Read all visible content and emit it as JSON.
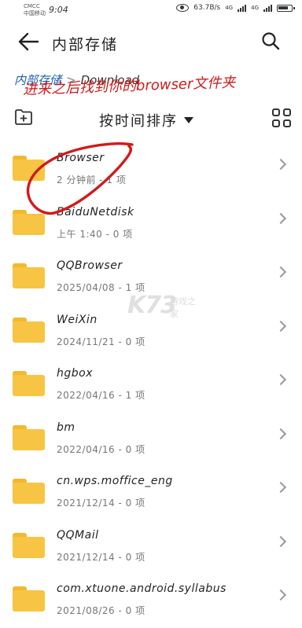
{
  "status_bar": {
    "carrier_top": "CMCC",
    "carrier_bottom": "中国移动",
    "time": "9:04",
    "network_speed": "63.7B/s",
    "signal_1": "4G",
    "signal_2": "4G"
  },
  "app_bar": {
    "title": "内部存储",
    "back_icon": "arrow-left-icon",
    "search_icon": "search-icon"
  },
  "breadcrumb": {
    "root": "内部存储",
    "separator": ">",
    "current": "Download"
  },
  "annotation_text": "进来之后找到你的browser文件夹",
  "toolbar": {
    "sort_label": "按时间排序",
    "new_folder_icon": "new-folder-icon",
    "view_icon": "grid-view-icon"
  },
  "folders": [
    {
      "name": "Browser",
      "meta": "2 分钟前 - 1 项"
    },
    {
      "name": "BaiduNetdisk",
      "meta": "上午 1:40 - 0 项"
    },
    {
      "name": "QQBrowser",
      "meta": "2025/04/08 - 1 项"
    },
    {
      "name": "WeiXin",
      "meta": "2024/11/21 - 0 项"
    },
    {
      "name": "hgbox",
      "meta": "2022/04/16 - 1 项"
    },
    {
      "name": "bm",
      "meta": "2022/04/16 - 0 项"
    },
    {
      "name": "cn.wps.moffice_eng",
      "meta": "2021/12/14 - 0 项"
    },
    {
      "name": "QQMail",
      "meta": "2021/12/14 - 0 项"
    },
    {
      "name": "com.xtuone.android.syllabus",
      "meta": "2021/08/26 - 0 项"
    }
  ],
  "watermark": {
    "logo": "K73",
    "site": "游戏之家"
  },
  "colors": {
    "folder": "#f7c543",
    "annotation": "#d11a1a",
    "breadcrumb_root": "#1a5fb4"
  }
}
